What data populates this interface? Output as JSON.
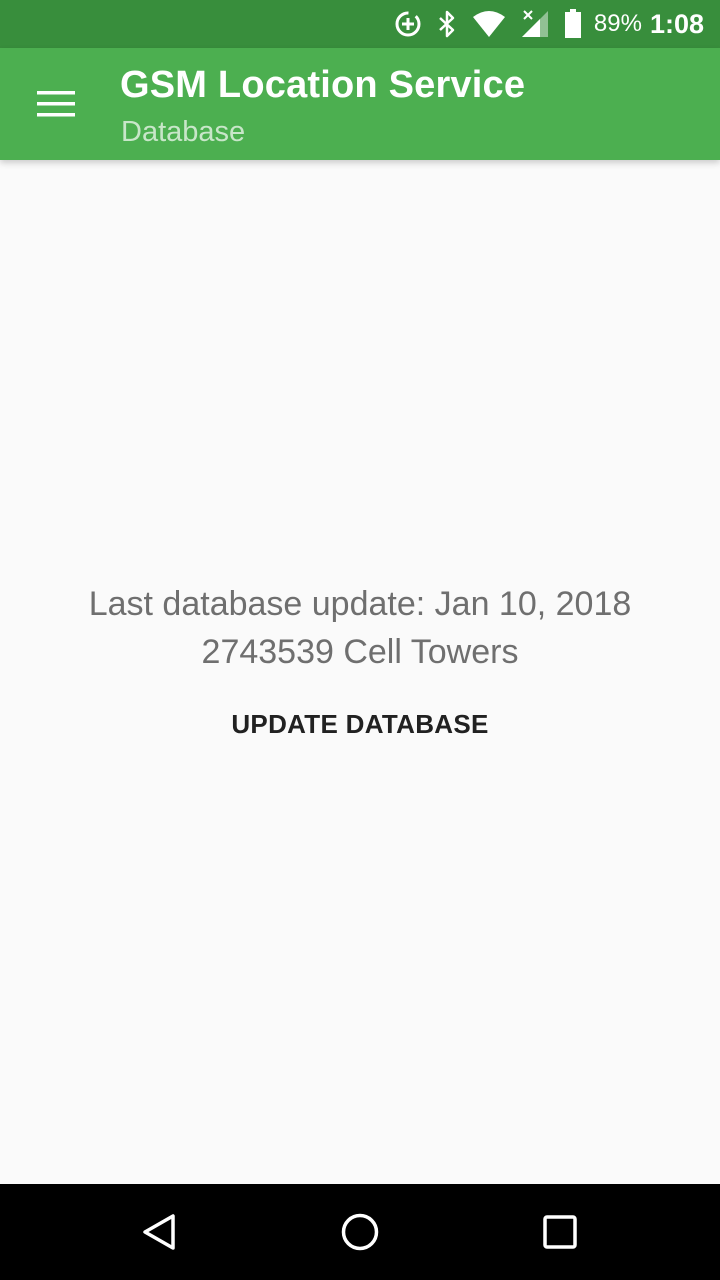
{
  "status_bar": {
    "battery_percent": "89%",
    "time": "1:08",
    "icons": [
      "data-saver-icon",
      "bluetooth-icon",
      "wifi-icon",
      "cellular-signal-icon",
      "battery-icon"
    ]
  },
  "app_bar": {
    "title": "GSM Location Service",
    "subtitle": "Database",
    "menu_icon": "hamburger-menu-icon"
  },
  "content": {
    "last_update": "Last database update: Jan 10, 2018",
    "tower_count": "2743539 Cell Towers",
    "update_button_label": "UPDATE DATABASE"
  },
  "nav_bar": {
    "icons": [
      "back-icon",
      "home-icon",
      "recents-icon"
    ]
  },
  "colors": {
    "status_bar": "#388e3c",
    "app_bar": "#4caf50",
    "subtitle": "#c8e6c9",
    "background": "#fafafa",
    "info_text": "#6f6f6f",
    "button_text": "#212121"
  }
}
